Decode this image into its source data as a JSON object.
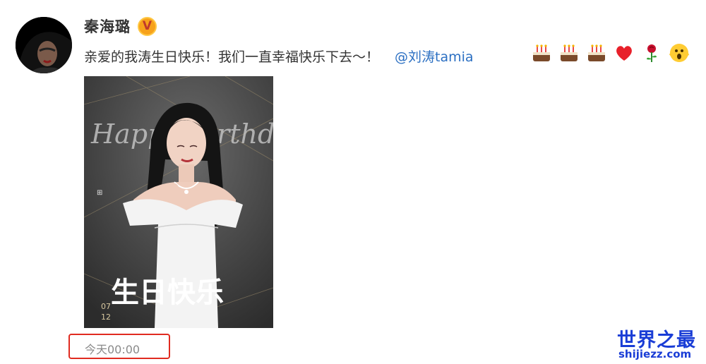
{
  "post": {
    "username": "秦海璐",
    "verified_badge": "V",
    "text": "亲爱的我涛生日快乐！我们一直幸福快乐下去～！",
    "mention": "@刘涛tamia",
    "emojis": [
      "cake-emoji",
      "cake-emoji",
      "cake-emoji",
      "heart-emoji",
      "rose-emoji",
      "shocked-face-emoji"
    ],
    "timestamp": "今天00:00"
  },
  "poster": {
    "script_text": "Happy Birthday",
    "caption": "生日快乐",
    "month": "07",
    "day": "12"
  },
  "watermark": {
    "title": "世界之最",
    "url": "shijiezz.com"
  },
  "colors": {
    "mention": "#2b6fc2",
    "highlight_box": "#e02b20",
    "watermark": "#1a3dd6",
    "badge": "#f7a21b"
  }
}
